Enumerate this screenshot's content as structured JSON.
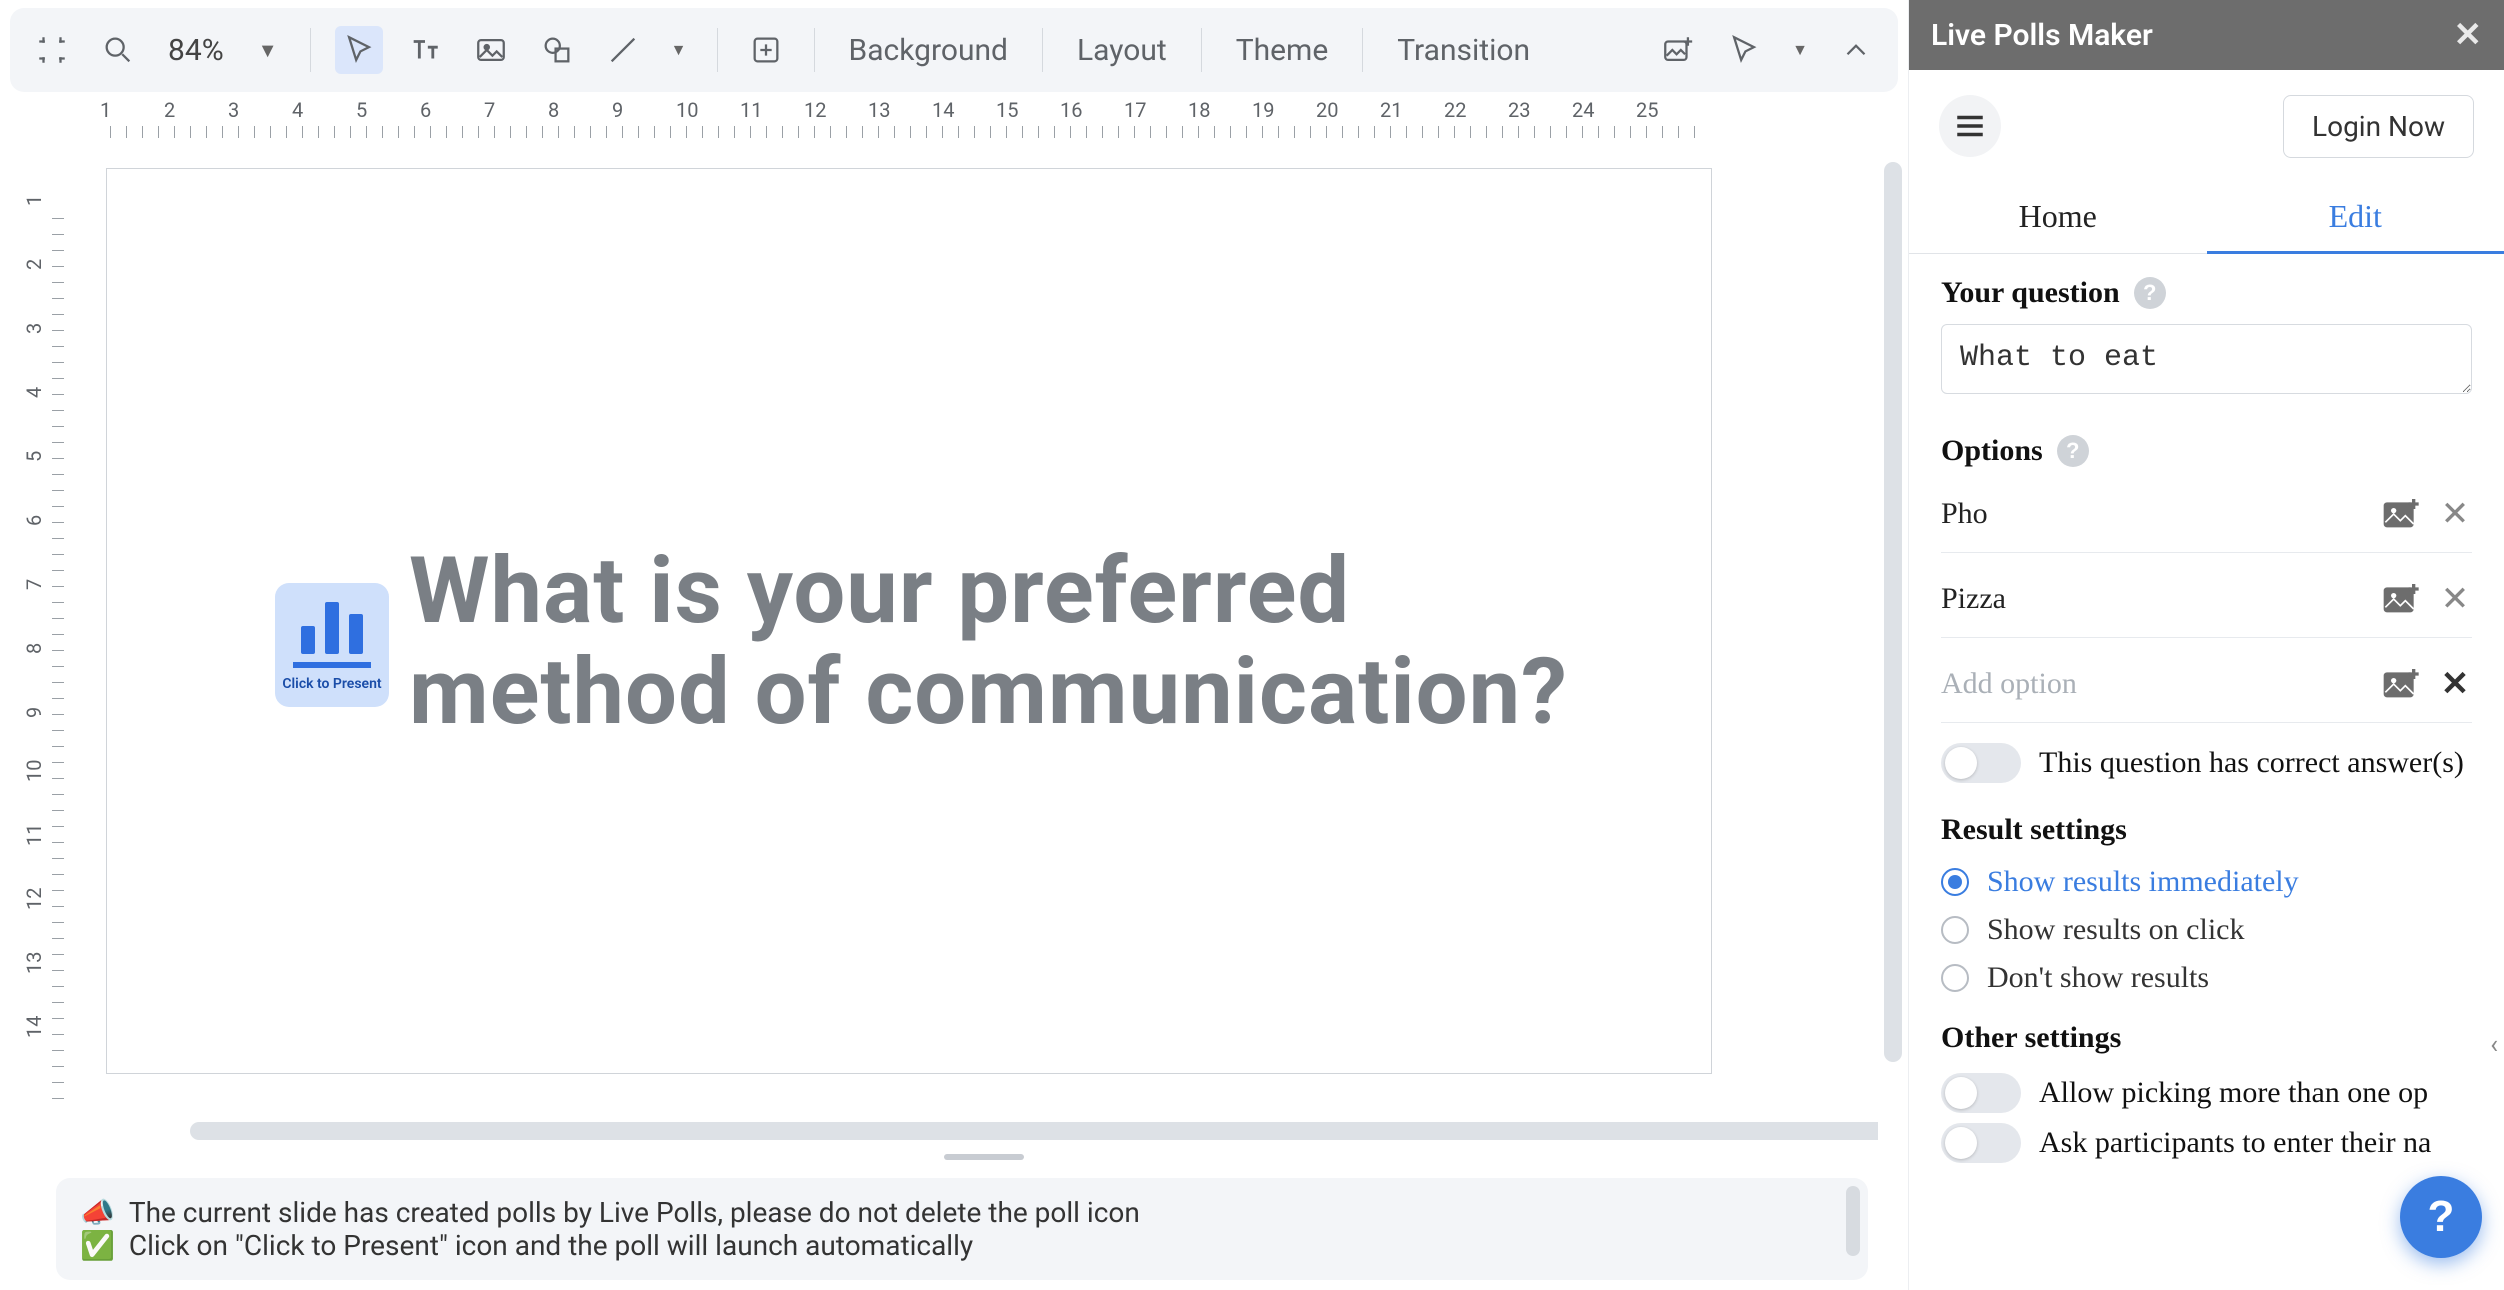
{
  "toolbar": {
    "zoom": "84%",
    "background": "Background",
    "layout": "Layout",
    "theme": "Theme",
    "transition": "Transition"
  },
  "ruler_h": [
    "1",
    "2",
    "3",
    "4",
    "5",
    "6",
    "7",
    "8",
    "9",
    "10",
    "11",
    "12",
    "13",
    "14",
    "15",
    "16",
    "17",
    "18",
    "19",
    "20",
    "21",
    "22",
    "23",
    "24",
    "25"
  ],
  "ruler_v": [
    "1",
    "2",
    "3",
    "4",
    "5",
    "6",
    "7",
    "8",
    "9",
    "10",
    "11",
    "12",
    "13",
    "14"
  ],
  "slide": {
    "poll_caption": "Click to Present",
    "title": "What is your preferred method of communication?"
  },
  "notes": {
    "line1_icon": "📣",
    "line1": "The current slide has created polls by Live Polls, please do not delete the poll icon",
    "line2_icon": "✅",
    "line2": "Click on \"Click to Present\" icon and the poll will launch automatically"
  },
  "panel": {
    "title": "Live Polls Maker",
    "login": "Login Now",
    "tabs": {
      "home": "Home",
      "edit": "Edit"
    },
    "question_label": "Your question",
    "question_value": "What to eat",
    "options_label": "Options",
    "options": [
      {
        "value": "Pho"
      },
      {
        "value": "Pizza"
      }
    ],
    "add_option_placeholder": "Add option",
    "correct_answer_label": "This question has correct answer(s)",
    "result_settings_label": "Result settings",
    "result_options": [
      {
        "label": "Show results immediately",
        "checked": true
      },
      {
        "label": "Show results on click",
        "checked": false
      },
      {
        "label": "Don't show results",
        "checked": false
      }
    ],
    "other_settings_label": "Other settings",
    "other_toggles": [
      {
        "label": "Allow picking more than one op"
      },
      {
        "label": "Ask participants to enter their na"
      }
    ],
    "help_badge": "?",
    "fab": "?"
  }
}
